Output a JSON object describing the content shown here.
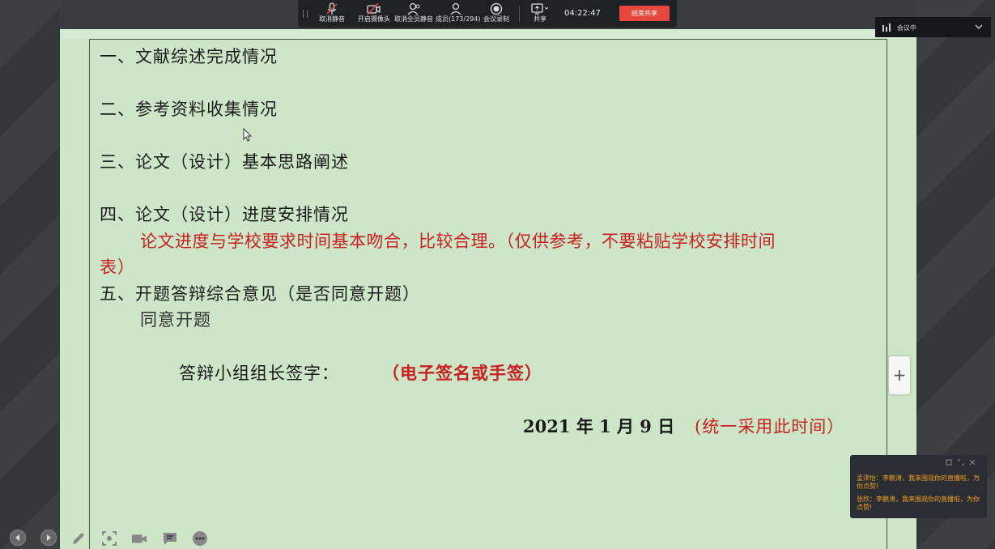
{
  "toolbar": {
    "buttons": [
      {
        "label": "取消静音",
        "icon": "microphone-icon"
      },
      {
        "label": "开启摄像头",
        "icon": "camera-off-icon"
      },
      {
        "label": "取消全员静音",
        "icon": "mute-all-icon"
      },
      {
        "label": "成员(173/294)",
        "icon": "members-icon"
      },
      {
        "label": "会议录制",
        "icon": "record-icon"
      },
      {
        "label": "共享",
        "icon": "share-screen-icon"
      }
    ],
    "time": "04:22:47",
    "end_share_label": "结束共享"
  },
  "meeting_status": {
    "text": "会议中"
  },
  "document": {
    "line1": "一、文献综述完成情况",
    "line2": "二、参考资料收集情况",
    "line3": "三、论文（设计）基本思路阐述",
    "line4": "四、论文（设计）进度安排情况",
    "line5a": "论文进度与学校要求时间基本吻合，比较合理。（仅供参考，不要粘贴学校安排时间",
    "line5b": "表）",
    "line6": "五、开题答辩综合意见（是否同意开题）",
    "line7": "同意开题",
    "signature_label": "答辩小组组长签字：",
    "signature_note": "（电子签名或手签）",
    "date": "2021 年  1 月 9  日",
    "date_note": "(统一采用此时间）"
  },
  "chat": {
    "messages": [
      "孟泽怡：李鹏涛，我来围观你的直播啦，为你点赞!",
      "张欣：李鹏涛，我来围观你的直播啦，为你点赞!"
    ]
  },
  "plus_button": "+",
  "colors": {
    "page_background": "#cde6c8",
    "red_text": "#cc1f1f",
    "end_share": "#e8473d",
    "chat_text": "#f0a01e"
  }
}
